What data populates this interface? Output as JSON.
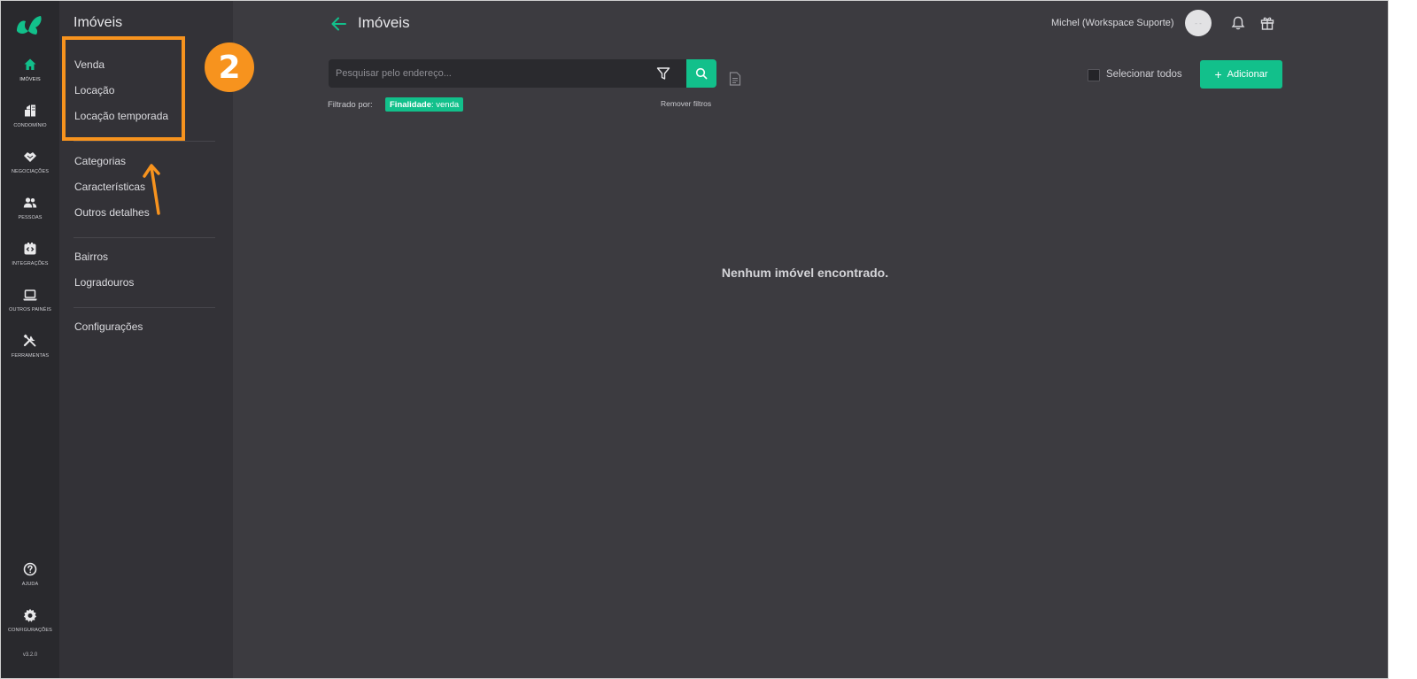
{
  "rail": {
    "items": [
      {
        "label": "IMÓVEIS",
        "icon": "home-icon"
      },
      {
        "label": "CONDOMÍNIO",
        "icon": "building-icon"
      },
      {
        "label": "NEGOCIAÇÕES",
        "icon": "handshake-icon"
      },
      {
        "label": "PESSOAS",
        "icon": "people-icon"
      },
      {
        "label": "INTEGRAÇÕES",
        "icon": "integration-icon"
      },
      {
        "label": "OUTROS PAINÉIS",
        "icon": "laptop-icon"
      },
      {
        "label": "FERRAMENTAS",
        "icon": "tools-icon"
      }
    ],
    "bottom": [
      {
        "label": "AJUDA",
        "icon": "help-icon"
      },
      {
        "label": "CONFIGURAÇÕES",
        "icon": "gear-icon"
      }
    ],
    "version": "v3.2.0"
  },
  "sidebar": {
    "title": "Imóveis",
    "group1": [
      "Venda",
      "Locação",
      "Locação temporada"
    ],
    "group2": [
      "Categorias",
      "Características",
      "Outros detalhes"
    ],
    "group3": [
      "Bairros",
      "Logradouros"
    ],
    "group4": [
      "Configurações"
    ]
  },
  "annotation": {
    "badge": "2",
    "color": "#f7931e"
  },
  "header": {
    "title": "Imóveis",
    "user": "Michel (Workspace Suporte)",
    "avatar_text": "- -"
  },
  "search": {
    "placeholder": "Pesquisar pelo endereço..."
  },
  "filters": {
    "label": "Filtrado por:",
    "chip_key": "Finalidade",
    "chip_value": ": venda",
    "remove": "Remover filtros"
  },
  "actions": {
    "select_all": "Selecionar todos",
    "add": "Adicionar"
  },
  "empty_message": "Nenhum imóvel encontrado.",
  "colors": {
    "accent": "#12c08b",
    "background": "#3c3b40",
    "rail": "#29292d",
    "sidebar": "#333237"
  }
}
